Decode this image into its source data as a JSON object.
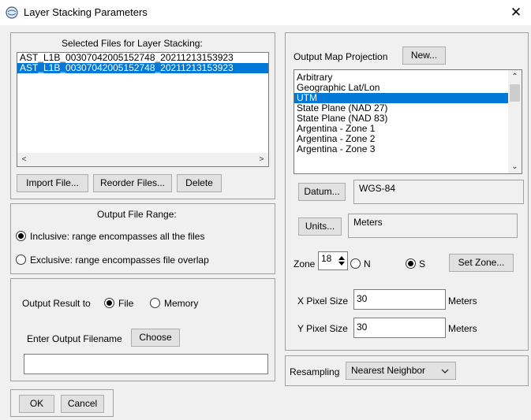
{
  "window": {
    "title": "Layer Stacking Parameters",
    "close_glyph": "✕"
  },
  "selected_files": {
    "heading": "Selected Files for Layer Stacking:",
    "items": [
      {
        "label": "AST_L1B_00307042005152748_20211213153923"
      },
      {
        "label": "AST_L1B_00307042005152748_20211213153923"
      }
    ],
    "import_label": "Import File...",
    "reorder_label": "Reorder Files...",
    "delete_label": "Delete"
  },
  "output_range": {
    "heading": "Output File Range:",
    "inclusive_label": "Inclusive: range encompasses all the files",
    "exclusive_label": "Exclusive: range encompasses file overlap"
  },
  "output": {
    "result_label": "Output Result to",
    "file_label": "File",
    "memory_label": "Memory",
    "filename_label": "Enter Output Filename",
    "choose_label": "Choose",
    "filename_value": ""
  },
  "projection": {
    "heading": "Output Map Projection",
    "new_label": "New...",
    "items": [
      {
        "label": "Arbitrary"
      },
      {
        "label": "Geographic Lat/Lon"
      },
      {
        "label": "UTM"
      },
      {
        "label": "State Plane (NAD 27)"
      },
      {
        "label": "State Plane (NAD 83)"
      },
      {
        "label": "Argentina - Zone 1"
      },
      {
        "label": "Argentina - Zone 2"
      },
      {
        "label": "Argentina - Zone 3"
      }
    ],
    "datum_label": "Datum...",
    "datum_value": "WGS-84",
    "units_label": "Units...",
    "units_value": "Meters",
    "zone_label": "Zone",
    "zone_value": "18",
    "north_label": "N",
    "south_label": "S",
    "set_zone_label": "Set Zone...",
    "x_pixel_label": "X Pixel Size",
    "x_pixel_value": "30",
    "x_pixel_units": "Meters",
    "y_pixel_label": "Y Pixel Size",
    "y_pixel_value": "30",
    "y_pixel_units": "Meters"
  },
  "resampling": {
    "label": "Resampling",
    "value": "Nearest Neighbor"
  },
  "footer": {
    "ok_label": "OK",
    "cancel_label": "Cancel"
  },
  "colors": {
    "selection": "#0078d7",
    "dialog_bg": "#f0f0f0"
  }
}
